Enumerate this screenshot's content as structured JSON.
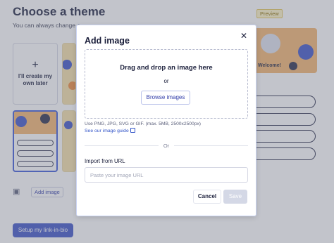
{
  "background": {
    "title": "Choose a theme",
    "subtitle": "You can always change c",
    "preview_badge": "Preview",
    "blank_tile": {
      "plus": "+",
      "label": "I'll create my own later"
    },
    "preview_welcome": "Welcome!",
    "add_image_button": "Add image",
    "setup_button": "Setup my link-in-bio"
  },
  "modal": {
    "title": "Add image",
    "close_icon": "close-icon",
    "dropzone": {
      "title": "Drag and drop an image here",
      "or": "or",
      "browse_label": "Browse images"
    },
    "hint": "Use PNG, JPG, SVG or GIF. (max. 5MB, 2500x2500px)",
    "guide_link": "See our image guide",
    "guide_icon": "external-link-icon",
    "divider_or": "Or",
    "url_label": "Import from URL",
    "url_placeholder": "Paste your image URL",
    "url_value": "",
    "cancel_label": "Cancel",
    "save_label": "Save"
  },
  "colors": {
    "primary": "#3d54c9",
    "link": "#2f52c7",
    "overlay": "rgba(110,114,130,0.42)",
    "save_disabled": "#d4d8e6"
  }
}
